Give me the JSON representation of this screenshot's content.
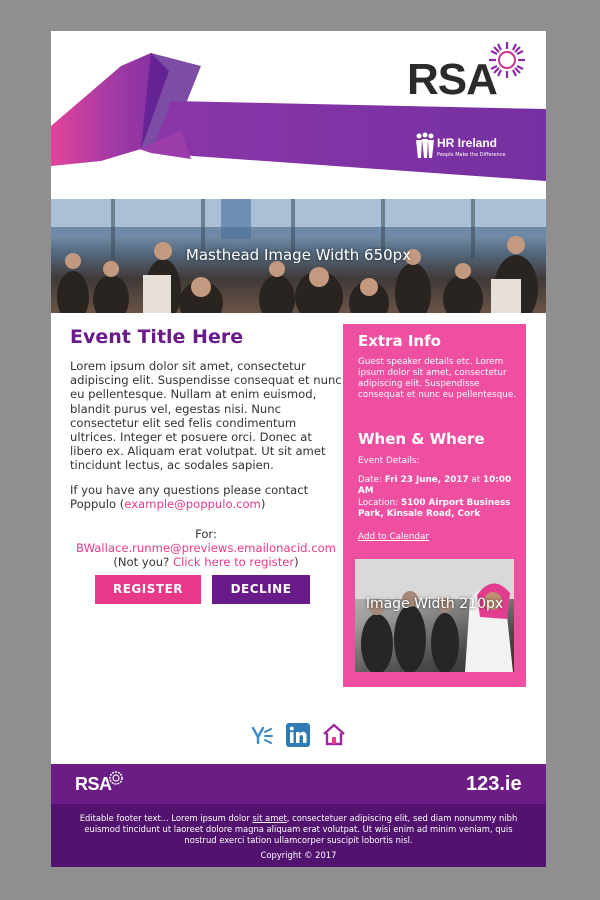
{
  "header": {
    "logo_text": "RSA",
    "hr_title": "HR Ireland",
    "hr_tagline": "People Make the Difference"
  },
  "masthead": {
    "label": "Masthead Image Width 650px"
  },
  "main": {
    "title": "Event Title Here",
    "body": "Lorem ipsum dolor sit amet, consectetur adipiscing elit. Suspendisse consequat et nunc eu pellentesque. Nullam at enim euismod, blandit purus vel, egestas nisi. Nunc consectetur elit sed felis condimentum ultrices. Integer et posuere orci. Donec at libero ex. Aliquam erat volutpat. Ut sit amet tincidunt lectus, ac sodales sapien.",
    "contact_prefix": "If you have any questions please contact Poppulo (",
    "contact_email": "example@poppulo.com",
    "contact_suffix": ")",
    "for_label": "For:",
    "recipient_email": "BWallace.runme@previews.emailonacid.com",
    "not_you_prefix": "(Not you? ",
    "not_you_link": "Click here to register",
    "not_you_suffix": ")",
    "register_label": "REGISTER",
    "decline_label": "DECLINE"
  },
  "sidebar": {
    "extra_title": "Extra Info",
    "extra_text": "Guest speaker details etc. Lorem ipsum dolor sit amet, consectetur adipiscing elit. Suspendisse consequat et nunc eu pellentesque.",
    "when_title": "When & Where",
    "details_label": "Event Details:",
    "date_label": "Date: ",
    "date_value": "Fri 23 June, 2017",
    "date_at": " at ",
    "time_value": "10:00 AM",
    "location_label": "Location: ",
    "location_value": "5100 Airport Business Park, Kinsale Road, Cork",
    "calendar_link": "Add to Calendar",
    "image_label": "Image Width 210px"
  },
  "social": [
    "yammer-icon",
    "linkedin-icon",
    "home-icon"
  ],
  "footer": {
    "rsa_text": "RSA",
    "brand_right": "123.ie",
    "text_prefix": "Editable footer text... Lorem ipsum dolor ",
    "text_link": "sit amet",
    "text_suffix": ", consectetuer adipiscing elit, sed diam nonummy nibh euismod tincidunt ut laoreet dolore magna aliquam erat volutpat. Ut wisi enim ad minim veniam, quis nostrud exerci tation ullamcorper suscipit lobortis nisl.",
    "copyright": "Copyright © 2017"
  },
  "colors": {
    "purple": "#6a1b8a",
    "pink": "#e8388a",
    "sidebar_pink": "#ef4fa0",
    "footer_top": "#6c1d85",
    "footer_bottom": "#51136e",
    "page_bg": "#8f8f8f"
  }
}
